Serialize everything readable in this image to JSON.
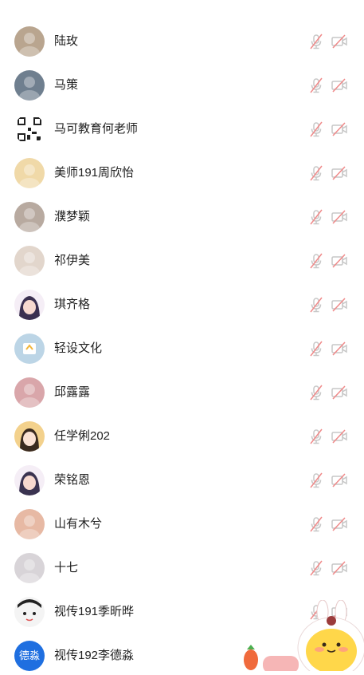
{
  "participants": [
    {
      "name": "陆玫",
      "avatar": "avatar-plush-toy",
      "color": "#b9a58f",
      "muted": true,
      "video_off": true
    },
    {
      "name": "马策",
      "avatar": "avatar-outdoor-photo",
      "color": "#6f7f8f",
      "muted": true,
      "video_off": true
    },
    {
      "name": "马可教育何老师",
      "avatar": "avatar-qr-code",
      "color": "#333333",
      "muted": true,
      "video_off": true
    },
    {
      "name": "美师191周欣怡",
      "avatar": "avatar-cake",
      "color": "#f0d9a8",
      "muted": true,
      "video_off": true
    },
    {
      "name": "濮梦颖",
      "avatar": "avatar-portrait",
      "color": "#b8aaa0",
      "muted": true,
      "video_off": true
    },
    {
      "name": "祁伊美",
      "avatar": "avatar-portrait-light",
      "color": "#e2d6cc",
      "muted": true,
      "video_off": true
    },
    {
      "name": "琪齐格",
      "avatar": "avatar-illustration-girl",
      "color": "#3b3050",
      "muted": true,
      "video_off": true
    },
    {
      "name": "轻设文化",
      "avatar": "avatar-logo-blue",
      "color": "#bcd5e6",
      "muted": true,
      "video_off": true
    },
    {
      "name": "邱露露",
      "avatar": "avatar-pink-photo",
      "color": "#d9a6aa",
      "muted": true,
      "video_off": true
    },
    {
      "name": "任学俐202",
      "avatar": "avatar-cartoon-girl",
      "color": "#f3d18c",
      "muted": true,
      "video_off": true
    },
    {
      "name": "荣铭恩",
      "avatar": "avatar-anime",
      "color": "#3a3350",
      "muted": true,
      "video_off": true
    },
    {
      "name": "山有木兮",
      "avatar": "avatar-flowers",
      "color": "#e7b9a4",
      "muted": true,
      "video_off": true
    },
    {
      "name": "十七",
      "avatar": "avatar-pastel",
      "color": "#d8d4d8",
      "muted": true,
      "video_off": true
    },
    {
      "name": "视传191季昕晔",
      "avatar": "avatar-cartoon-face",
      "color": "#f4f4f4",
      "muted": true,
      "video_off": true
    },
    {
      "name": "视传192李德淼",
      "avatar": "avatar-text-badge",
      "avatar_text": "德淼",
      "color": "#1f6fe0",
      "muted": true,
      "video_off": true
    }
  ],
  "colors": {
    "icon_gray": "#c7c7c7",
    "slash_red": "#f08a8a",
    "name_text": "#222222"
  },
  "mascot": "mascot-sticker"
}
